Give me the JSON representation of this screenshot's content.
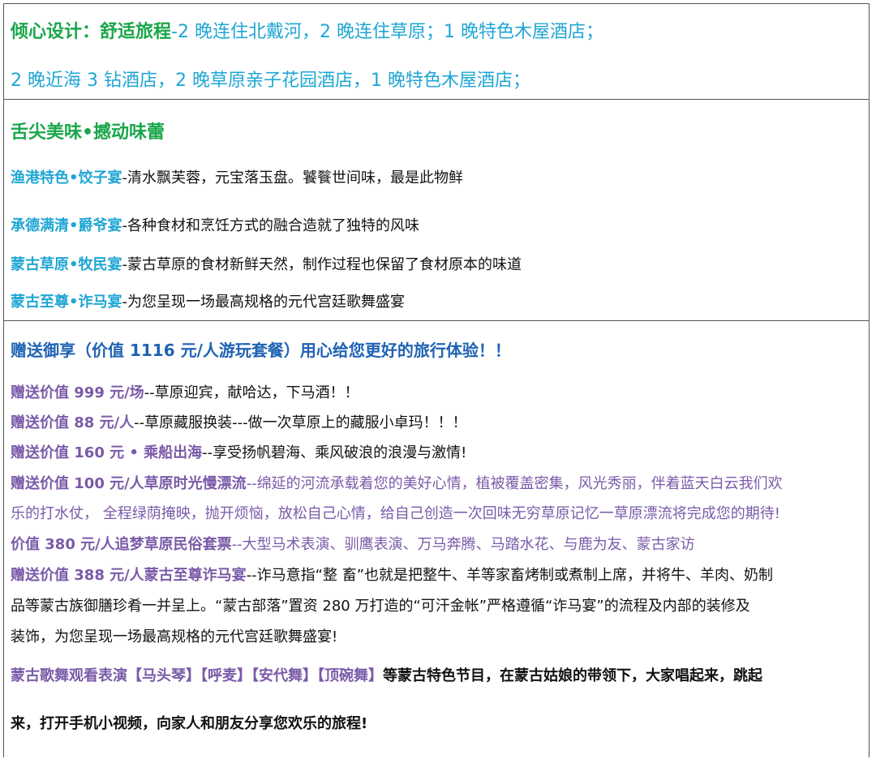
{
  "design": {
    "title": "倾心设计：舒适旅程",
    "sep": "-",
    "line1": "2 晚连住北戴河，2 晚连住草原；1 晚特色木屋酒店；",
    "line2": "2 晚近海 3 钻酒店，2 晚草原亲子花园酒店，1 晚特色木屋酒店；"
  },
  "food": {
    "title": "舌尖美味•撼动味蕾",
    "items": [
      {
        "name": "渔港特色•饺子宴",
        "desc": "-清水飘芙蓉，元宝落玉盘。饕餮世间味，最是此物鲜"
      },
      {
        "name": "承德满清•爵爷宴",
        "desc": "-各种食材和烹饪方式的融合造就了独特的风味"
      },
      {
        "name": "蒙古草原•牧民宴",
        "desc": "-蒙古草原的食材新鲜天然，制作过程也保留了食材原本的味道"
      },
      {
        "name": "蒙古至尊•诈马宴",
        "desc": "-为您呈现一场最高规格的元代宫廷歌舞盛宴"
      }
    ]
  },
  "gift": {
    "title": "赠送御享（价值 1116 元/人游玩套餐）用心给您更好的旅行体验！！",
    "items": [
      {
        "label": "赠送价值 999 元/场",
        "desc": "--草原迎宾，献哈达，下马酒！！"
      },
      {
        "label": "赠送价值 88 元/人",
        "desc": "--草原藏服换装---做一次草原上的藏服小卓玛！！！"
      },
      {
        "label": "赠送价值 160 元 • 乘船出海",
        "desc": "--享受扬帆碧海、乘风破浪的浪漫与激情!"
      },
      {
        "label": "赠送价值 100 元/人草原时光慢漂流",
        "desc1": "--绵延的河流承载着您的美好心情，植被覆盖密集，风光秀丽，伴着蓝天白云我们欢",
        "desc2": "乐的打水仗，  全程绿荫掩映，抛开烦恼，放松自己心情，给自己创造一次回味无穷草原记忆一草原漂流将完成您的期待!"
      },
      {
        "label": "价值 380 元/人追梦草原民俗套票",
        "desc": "--大型马术表演、驯鹰表演、万马奔腾、马踏水花、与鹿为友、蒙古家访"
      },
      {
        "label": "赠送价值 388 元/人蒙古至尊诈马宴",
        "desc1": "--诈马意指“整 畜”也就是把整牛、羊等家畜烤制或煮制上席，并将牛、羊肉、奶制",
        "desc2": "品等蒙古族御膳珍肴一并呈上。“蒙古部落”置资 280 万打造的“可汗金帐”严格遵循“诈马宴”的流程及内部的装修及",
        "desc3": "装饰，为您呈现一场最高规格的元代宫廷歌舞盛宴!"
      }
    ],
    "show": {
      "label": "蒙古歌舞观看表演【马头琴】【呼麦】【安代舞】【顶碗舞】",
      "text1": "等蒙古特色节目，在蒙古姑娘的带领下，大家唱起来，跳起",
      "text2": "来，打开手机小视频，向家人和朋友分享您欢乐的旅程!"
    }
  }
}
